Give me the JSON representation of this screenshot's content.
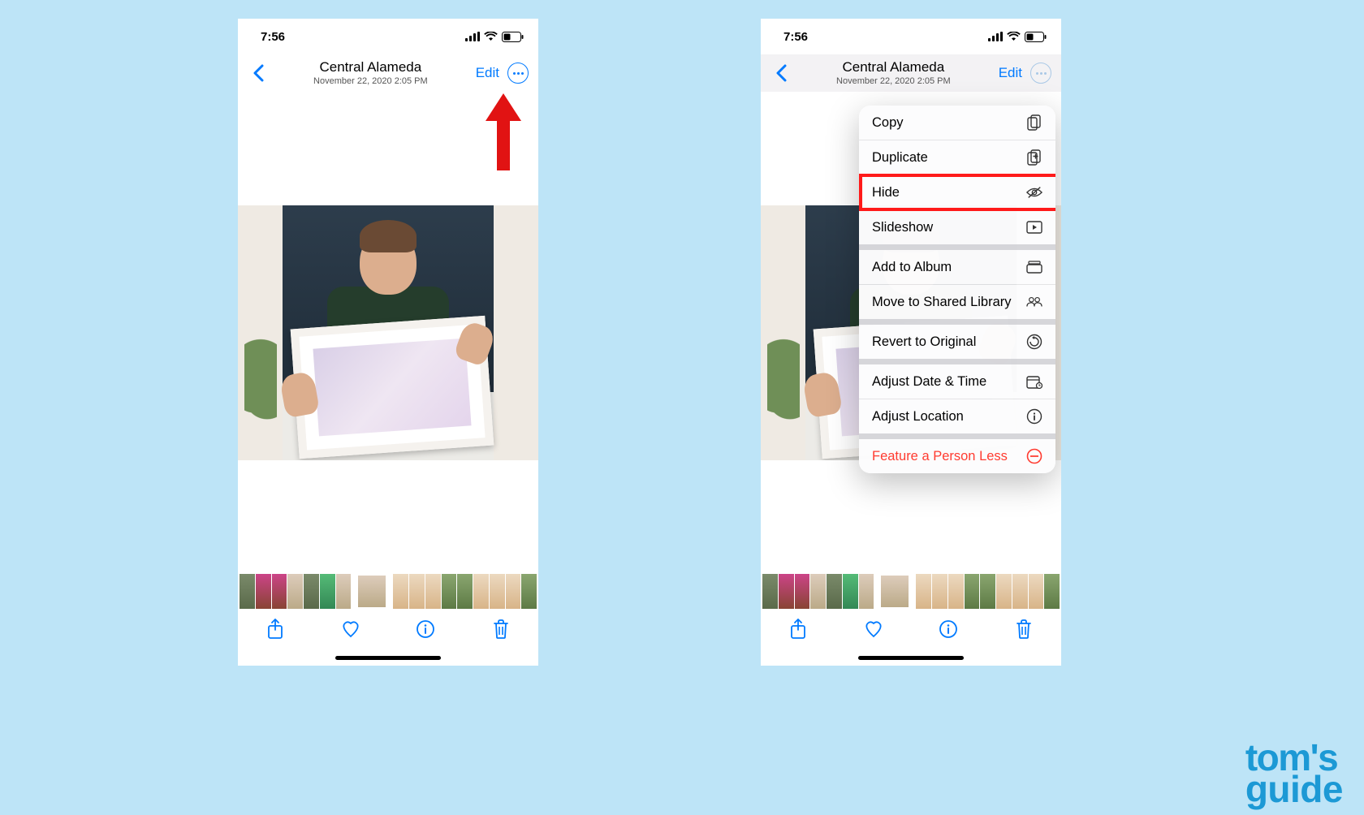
{
  "status": {
    "time": "7:56"
  },
  "nav": {
    "location": "Central Alameda",
    "datetime": "November 22, 2020  2:05 PM",
    "edit": "Edit"
  },
  "menu": {
    "copy": "Copy",
    "duplicate": "Duplicate",
    "hide": "Hide",
    "slideshow": "Slideshow",
    "add_album": "Add to Album",
    "move_shared": "Move to Shared Library",
    "revert": "Revert to Original",
    "adjust_dt": "Adjust Date & Time",
    "adjust_loc": "Adjust Location",
    "feature_less": "Feature a Person Less"
  },
  "attribution": {
    "line1": "tom's",
    "line2": "guide"
  }
}
